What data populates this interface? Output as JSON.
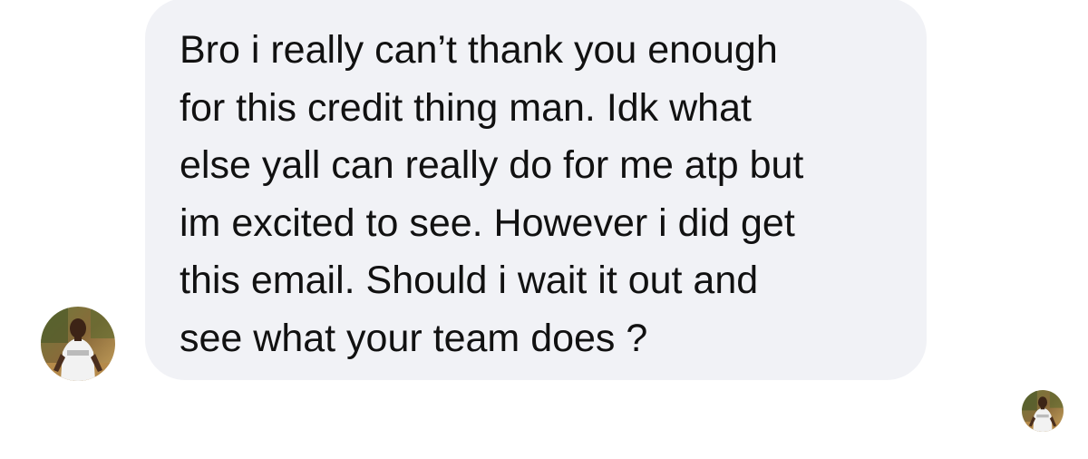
{
  "conversation": {
    "message": {
      "text": "Bro i really can’t thank you enough\nfor this credit thing man. Idk what\nelse yall can really do for me atp but\nim excited to see. However i did get\nthis email. Should i wait it out and\nsee what your team does ?"
    }
  },
  "colors": {
    "bubble_background": "#f1f2f6",
    "text": "#111111",
    "page_background": "#ffffff"
  },
  "icons": {
    "sender_avatar": "profile-photo-icon",
    "read_receipt": "read-receipt-avatar-icon"
  }
}
